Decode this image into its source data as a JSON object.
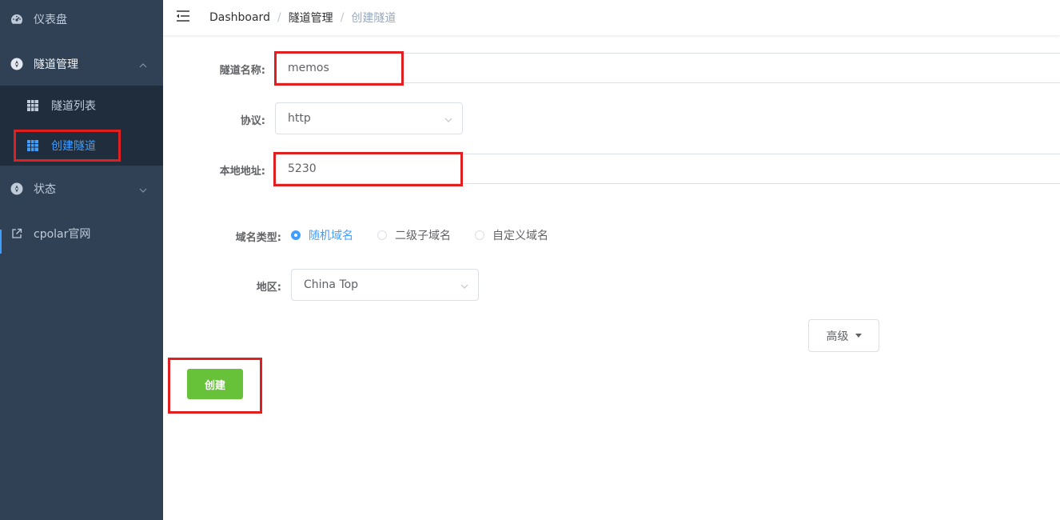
{
  "sidebar": {
    "dashboard": {
      "label": "仪表盘",
      "icon": "dashboard-icon"
    },
    "tunnel_mgmt": {
      "label": "隧道管理",
      "icon": "circle-nav-icon",
      "expanded": true
    },
    "tunnel_list": {
      "label": "隧道列表",
      "icon": "table-icon"
    },
    "create_tunnel": {
      "label": "创建隧道",
      "icon": "table-icon",
      "active": true
    },
    "status": {
      "label": "状态",
      "icon": "circle-nav-icon"
    },
    "website": {
      "label": "cpolar官网",
      "icon": "external-link-icon"
    }
  },
  "header": {
    "breadcrumb": [
      "Dashboard",
      "隧道管理",
      "创建隧道"
    ],
    "separator": "/"
  },
  "form": {
    "tunnel_name": {
      "label": "隧道名称:",
      "value": "memos"
    },
    "protocol": {
      "label": "协议:",
      "value": "http"
    },
    "local_address": {
      "label": "本地地址:",
      "value": "5230"
    },
    "domain_type": {
      "label": "域名类型:",
      "options": [
        "随机域名",
        "二级子域名",
        "自定义域名"
      ],
      "selected": "随机域名"
    },
    "region": {
      "label": "地区:",
      "value": "China Top"
    },
    "advanced_label": "高级",
    "create_label": "创建"
  },
  "colors": {
    "sidebar_bg": "#304156",
    "submenu_bg": "#1f2d3d",
    "active_text": "#409eff",
    "success": "#67c23a",
    "highlight": "#e02020"
  }
}
